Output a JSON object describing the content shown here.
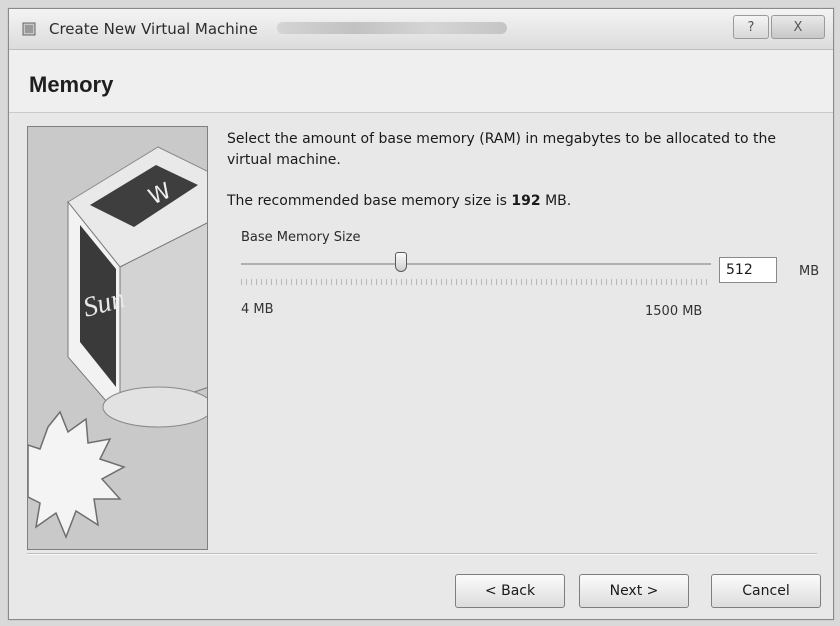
{
  "window": {
    "title": "Create New Virtual Machine",
    "help_label": "?",
    "close_label": "X"
  },
  "page": {
    "heading": "Memory"
  },
  "content": {
    "description": "Select the amount of base memory (RAM) in megabytes to be allocated to the virtual machine.",
    "recommended_prefix": "The recommended base memory size is ",
    "recommended_value": "192",
    "recommended_unit": " MB.",
    "memory_group_label": "Base Memory Size",
    "min_label": "4 MB",
    "max_label": "1500 MB",
    "slider_min": 4,
    "slider_max": 1500,
    "current_value": "512",
    "unit_label": "MB"
  },
  "sidebar_image": {
    "logo_text": "Sun"
  },
  "buttons": {
    "back": "< Back",
    "next": "Next >",
    "cancel": "Cancel"
  }
}
